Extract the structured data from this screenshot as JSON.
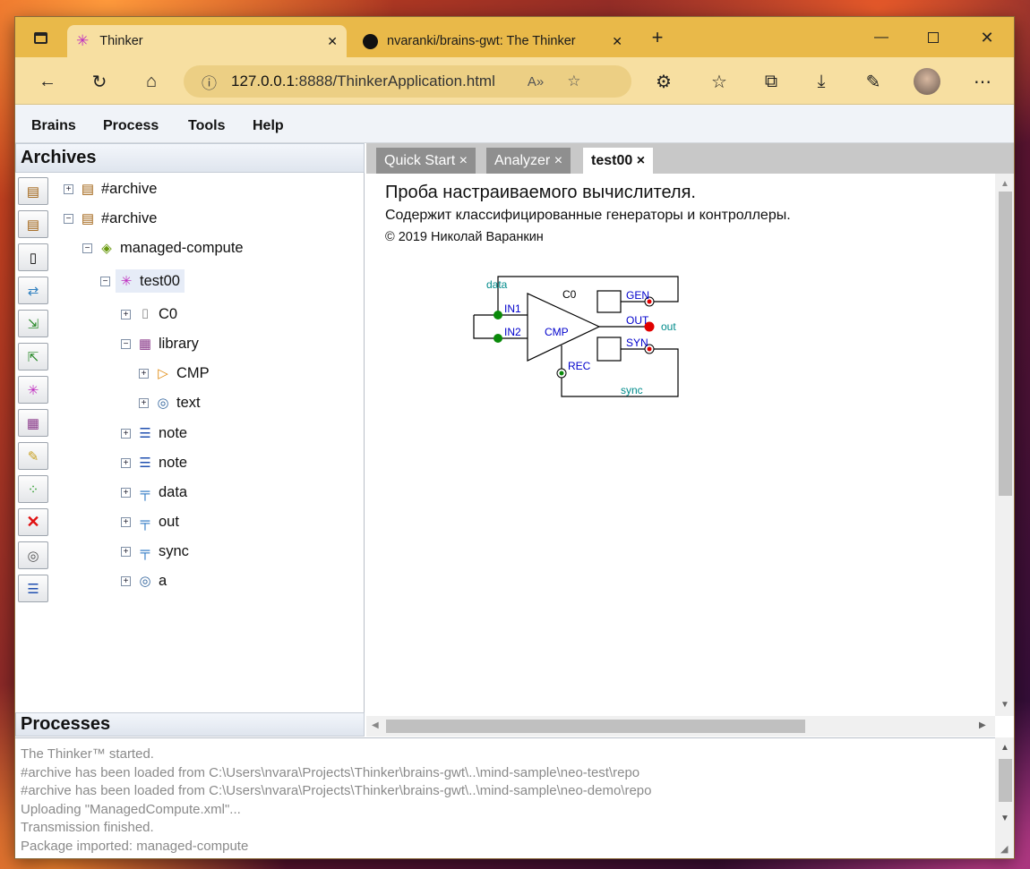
{
  "browser": {
    "tabs": [
      {
        "title": "Thinker",
        "close": "✕"
      },
      {
        "title": "nvaranki/brains-gwt: The Thinker",
        "close": "✕"
      }
    ],
    "url": {
      "info": "ⓘ",
      "host": "127.0.0.1",
      "rest": ":8888/ThinkerApplication.html"
    }
  },
  "menu": [
    "Brains",
    "Process",
    "Tools",
    "Help"
  ],
  "panels": {
    "archives": "Archives",
    "processes": "Processes"
  },
  "tree": [
    {
      "label": "#archive",
      "icon": "archive-icon",
      "expander": "+"
    },
    {
      "label": "#archive",
      "icon": "archive-icon",
      "expander": "−"
    },
    {
      "label": "managed-compute",
      "icon": "package-icon",
      "expander": "−"
    },
    {
      "label": "test00",
      "icon": "network-icon",
      "expander": "−"
    },
    {
      "label": "C0",
      "icon": "container-icon",
      "expander": "+"
    },
    {
      "label": "library",
      "icon": "library-icon",
      "expander": "−"
    },
    {
      "label": "CMP",
      "icon": "comparator-icon",
      "expander": "+"
    },
    {
      "label": "text",
      "icon": "eye-icon",
      "expander": "+"
    },
    {
      "label": "note",
      "icon": "list-icon",
      "expander": "+"
    },
    {
      "label": "note",
      "icon": "list-icon",
      "expander": "+"
    },
    {
      "label": "data",
      "icon": "bus-icon",
      "expander": "+"
    },
    {
      "label": "out",
      "icon": "bus-icon",
      "expander": "+"
    },
    {
      "label": "sync",
      "icon": "bus-icon",
      "expander": "+"
    },
    {
      "label": "a",
      "icon": "eye-icon",
      "expander": "+"
    }
  ],
  "content_tabs": [
    {
      "label": "Quick Start ×"
    },
    {
      "label": "Analyzer ×"
    },
    {
      "label": "test00 ×"
    }
  ],
  "doc": {
    "title": "Проба настраиваемого вычислителя.",
    "subtitle": "Содержит классифицированные генераторы и контроллеры.",
    "copyright": "© 2019 Николай Варанкин"
  },
  "diagram": {
    "data": "data",
    "c0": "C0",
    "gen": "GEN",
    "in1": "IN1",
    "out_port": "OUT",
    "out": "out",
    "in2": "IN2",
    "cmp": "CMP",
    "syn": "SYN",
    "rec": "REC",
    "sync": "sync",
    "colors": {
      "wire": "#000000",
      "teal": "#008b8b",
      "blue": "#0000cc",
      "green": "#0a8a0a",
      "red": "#e00000"
    }
  },
  "log": [
    "The Thinker™ started.",
    "#archive has been loaded from C:\\Users\\nvara\\Projects\\Thinker\\brains-gwt\\..\\mind-sample\\neo-test\\repo",
    "#archive has been loaded from C:\\Users\\nvara\\Projects\\Thinker\\brains-gwt\\..\\mind-sample\\neo-demo\\repo",
    "Uploading \"ManagedCompute.xml\"...",
    "Transmission finished.",
    "Package imported: managed-compute"
  ]
}
